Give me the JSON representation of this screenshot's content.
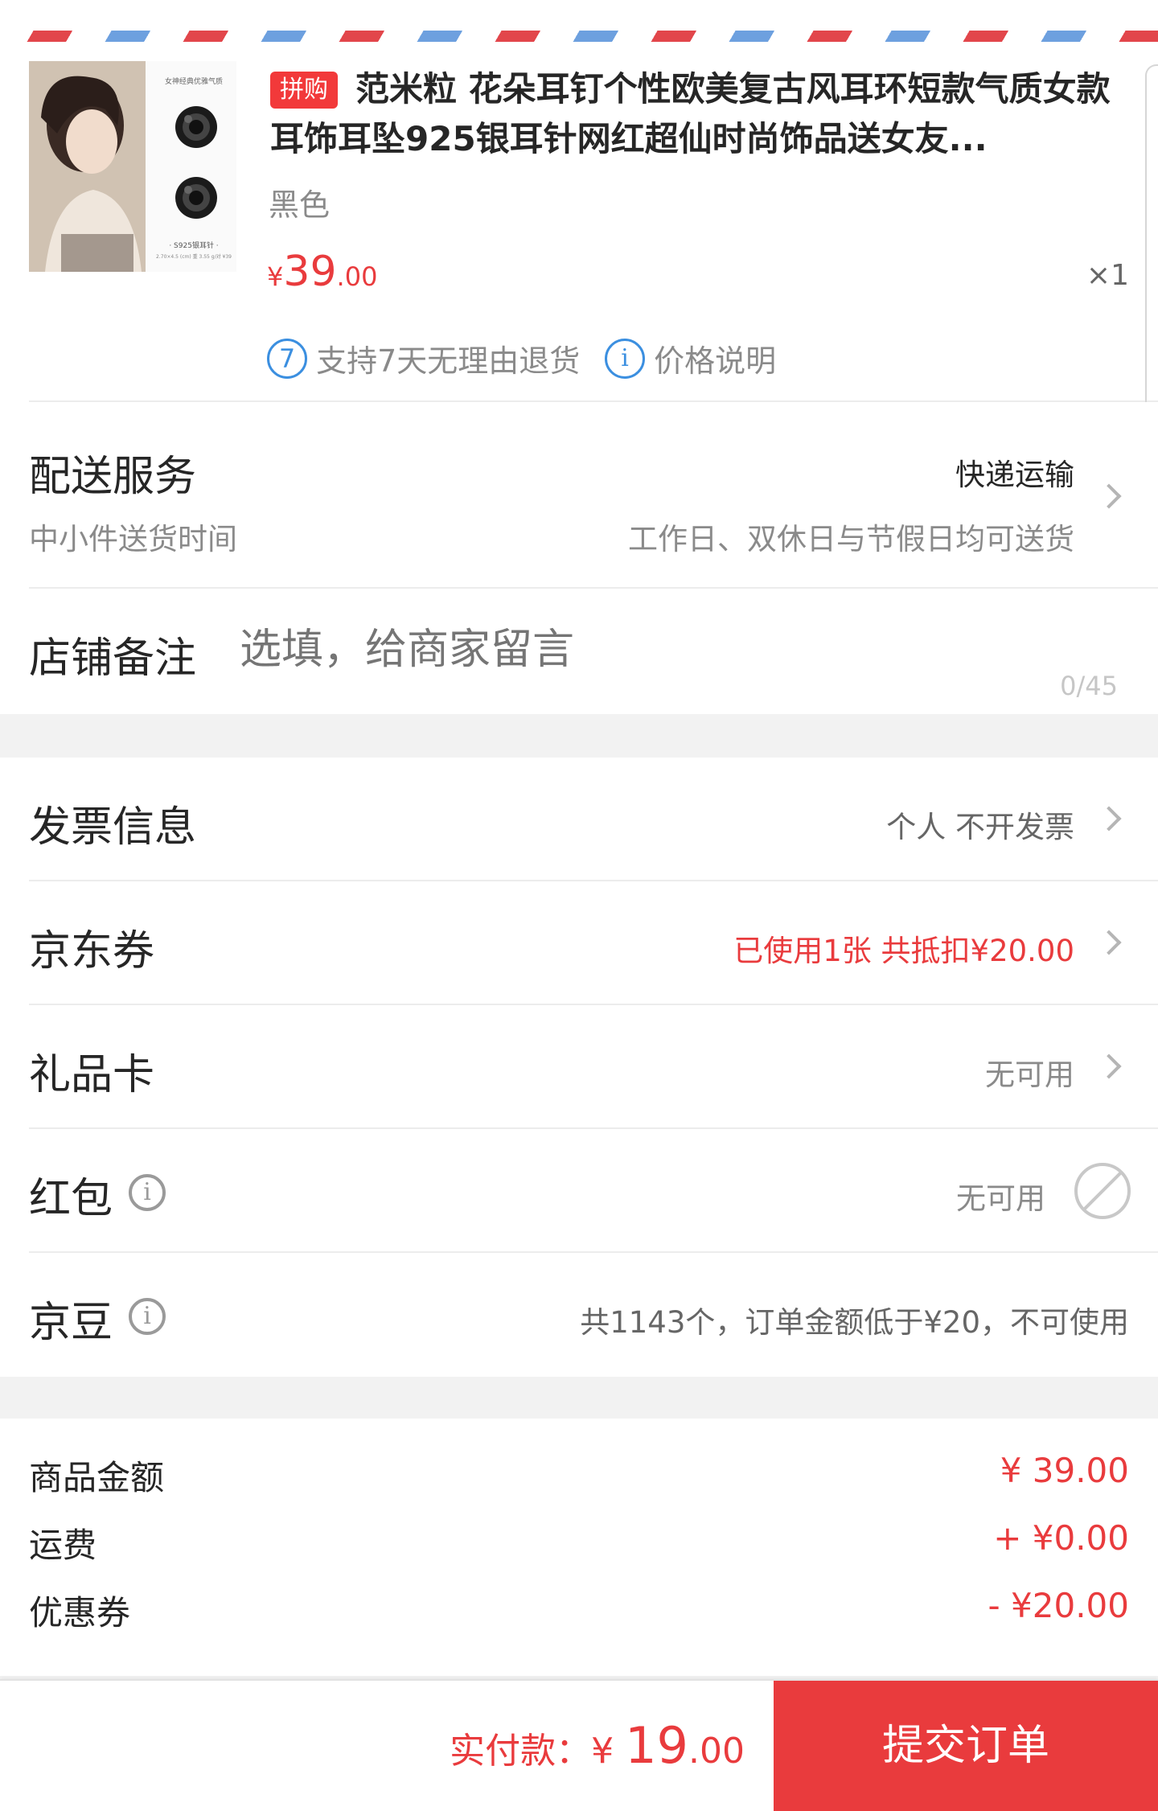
{
  "product": {
    "tag": "拼购",
    "title": "范米粒 花朵耳钉个性欧美复古风耳环短款气质女款耳饰耳坠925银耳针网红超仙时尚饰品送女友...",
    "variant": "黑色",
    "currency": "¥",
    "price_int": "39",
    "price_dec": ".00",
    "qty": "×1",
    "return_badge": "7",
    "return_text": "支持7天无理由退货",
    "info_badge": "i",
    "price_note": "价格说明",
    "image": {
      "header": "女神经典优雅气质",
      "caption": "· S925银耳针 ·",
      "caption2": "2.70×4.5 (cm) 重 3.55 g/对 ¥39"
    }
  },
  "delivery": {
    "label": "配送服务",
    "method": "快递运输",
    "sublabel": "中小件送货时间",
    "schedule": "工作日、双休日与节假日均可送货"
  },
  "note": {
    "label": "店铺备注",
    "placeholder": "选填，给商家留言",
    "counter": "0/45"
  },
  "invoice": {
    "label": "发票信息",
    "value": "个人 不开发票"
  },
  "coupon": {
    "label": "京东券",
    "value": "已使用1张 共抵扣¥20.00"
  },
  "giftcard": {
    "label": "礼品卡",
    "value": "无可用"
  },
  "redpacket": {
    "label": "红包",
    "icon": "i",
    "value": "无可用"
  },
  "jingdou": {
    "label": "京豆",
    "icon": "i",
    "value": "共1143个，订单金额低于¥20，不可使用"
  },
  "summary": {
    "goods_label": "商品金额",
    "goods_value": "¥ 39.00",
    "shipping_label": "运费",
    "shipping_value": "+ ¥0.00",
    "discount_label": "优惠券",
    "discount_value": "- ¥20.00"
  },
  "footer": {
    "pay_label": "实付款：",
    "currency": "¥ ",
    "amount_int": "19",
    "amount_dec": ".00",
    "submit": "提交订单"
  },
  "colors": {
    "accent": "#e93b3d",
    "blue": "#3b8fe0"
  }
}
